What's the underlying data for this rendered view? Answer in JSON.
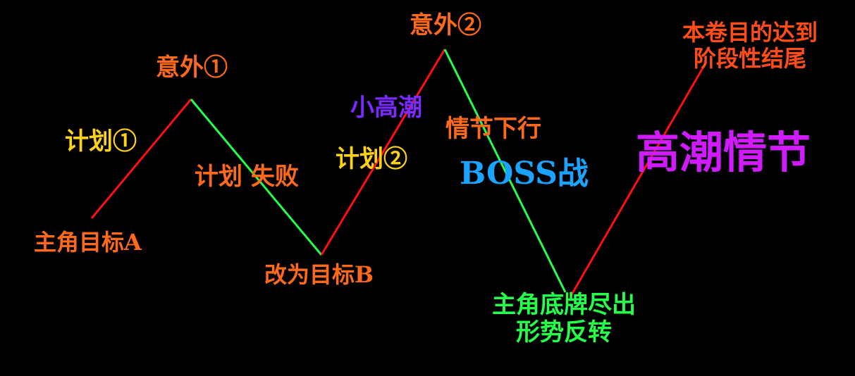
{
  "colors": {
    "background": "#000000",
    "rising_line": "#ff1010",
    "falling_line": "#26ff4a",
    "orange_text": "#ff6a1a",
    "yellow_text": "#ffd21a",
    "green_text": "#26ff4a",
    "purple_text": "#7b2bff",
    "blue_text": "#1aa3ff",
    "magenta_text": "#d21aff"
  },
  "labels": {
    "goal_a": "主角目标A",
    "plan1": "计划①",
    "accident1": "意外①",
    "plan_fail": "计划 失败",
    "goal_b": "改为目标B",
    "plan2": "计划②",
    "mini_climax": "小高潮",
    "accident2": "意外②",
    "plot_down": "情节下行",
    "boss_battle": "BOSS战",
    "trump_card_line1": "主角底牌尽出",
    "trump_card_line2": "形势反转",
    "climax_plot": "高潮情节",
    "volume_end_line1": "本卷目的达到",
    "volume_end_line2": "阶段性结尾"
  }
}
